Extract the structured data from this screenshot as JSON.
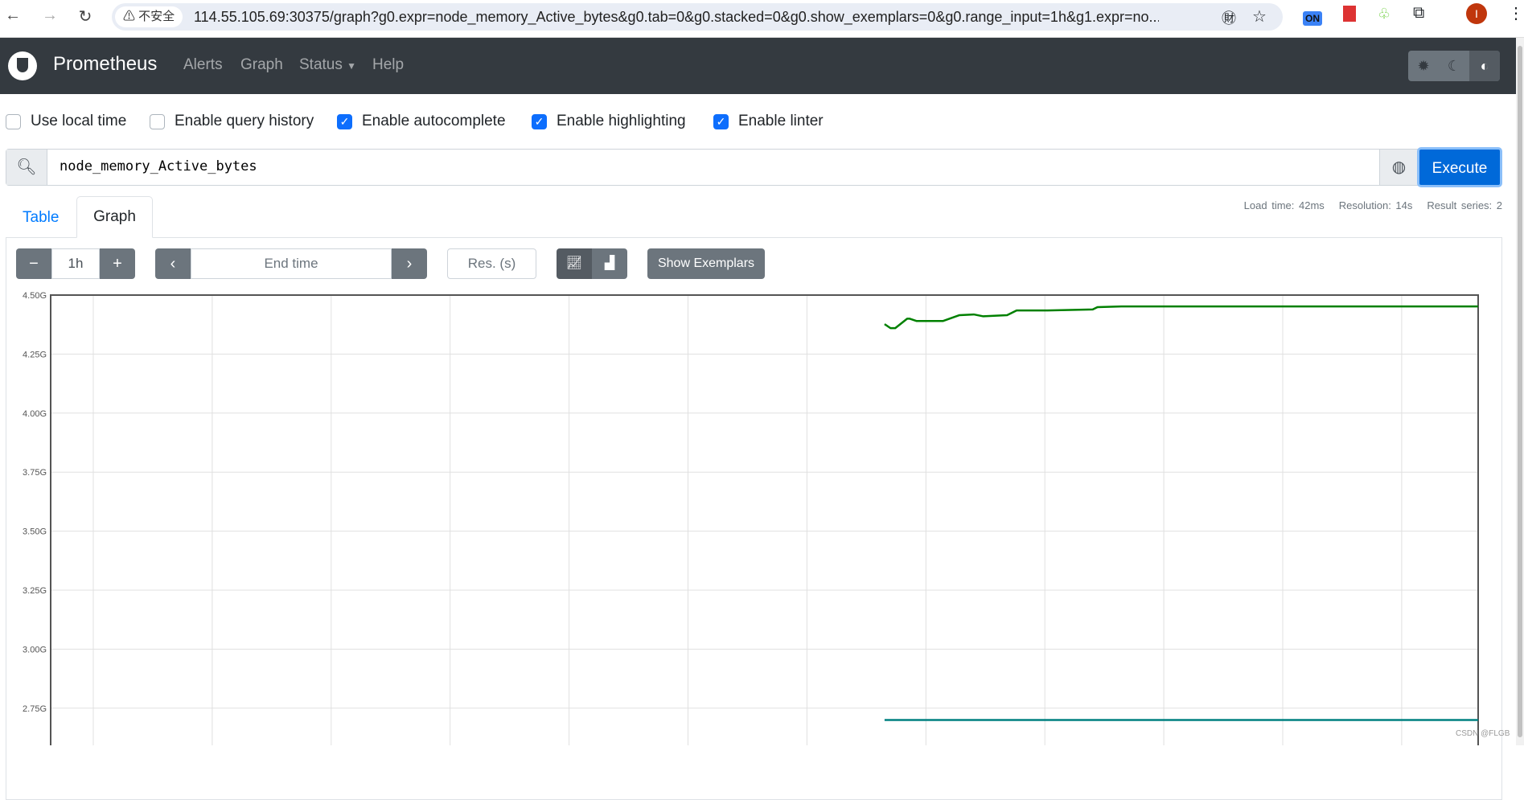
{
  "browser": {
    "security_label": "不安全",
    "url": "114.55.105.69:30375/graph?g0.expr=node_memory_Active_bytes&g0.tab=0&g0.stacked=0&g0.show_exemplars=0&g0.range_input=1h&g1.expr=no...",
    "ext_on_label": "ON",
    "avatar_letter": "I"
  },
  "navbar": {
    "brand": "Prometheus",
    "items": [
      "Alerts",
      "Graph",
      "Status",
      "Help"
    ]
  },
  "options": [
    {
      "label": "Use local time",
      "checked": false
    },
    {
      "label": "Enable query history",
      "checked": false
    },
    {
      "label": "Enable autocomplete",
      "checked": true
    },
    {
      "label": "Enable highlighting",
      "checked": true
    },
    {
      "label": "Enable linter",
      "checked": true
    }
  ],
  "query": {
    "value": "node_memory_Active_bytes",
    "execute_label": "Execute"
  },
  "stats": {
    "load_time": "Load time: 42ms",
    "resolution": "Resolution: 14s",
    "result_series": "Result series: 2"
  },
  "tabs": [
    "Table",
    "Graph"
  ],
  "controls": {
    "range": "1h",
    "end_time_placeholder": "End time",
    "res_placeholder": "Res. (s)",
    "show_exemplars": "Show Exemplars",
    "minus": "−",
    "plus": "+"
  },
  "watermark": "CSDN @FLGB",
  "chart_data": {
    "type": "line",
    "xlabel": "",
    "ylabel": "",
    "x_units": "minutes within 1h range",
    "xlim": [
      0,
      60
    ],
    "y_ticks": [
      "4.50G",
      "4.25G",
      "4.00G",
      "3.75G",
      "3.50G",
      "3.25G",
      "3.00G",
      "2.75G"
    ],
    "y_tick_values": [
      4.5,
      4.25,
      4.0,
      3.75,
      3.5,
      3.25,
      3.0,
      2.75
    ],
    "ylim_top": 4.5,
    "grid": true,
    "series": [
      {
        "color": "#008000",
        "points": [
          [
            35.05,
            4.377
          ],
          [
            35.3,
            4.36
          ],
          [
            35.5,
            4.36
          ],
          [
            36.0,
            4.4
          ],
          [
            36.1,
            4.4
          ],
          [
            36.4,
            4.39
          ],
          [
            37.5,
            4.39
          ],
          [
            38.2,
            4.415
          ],
          [
            38.8,
            4.418
          ],
          [
            39.2,
            4.41
          ],
          [
            40.2,
            4.415
          ],
          [
            40.6,
            4.435
          ],
          [
            41.9,
            4.435
          ],
          [
            43.8,
            4.439
          ],
          [
            44.0,
            4.449
          ],
          [
            45.0,
            4.452
          ],
          [
            60,
            4.452
          ]
        ]
      },
      {
        "color": "#008080",
        "points": [
          [
            35.05,
            2.7
          ],
          [
            60,
            2.7
          ]
        ]
      }
    ]
  }
}
